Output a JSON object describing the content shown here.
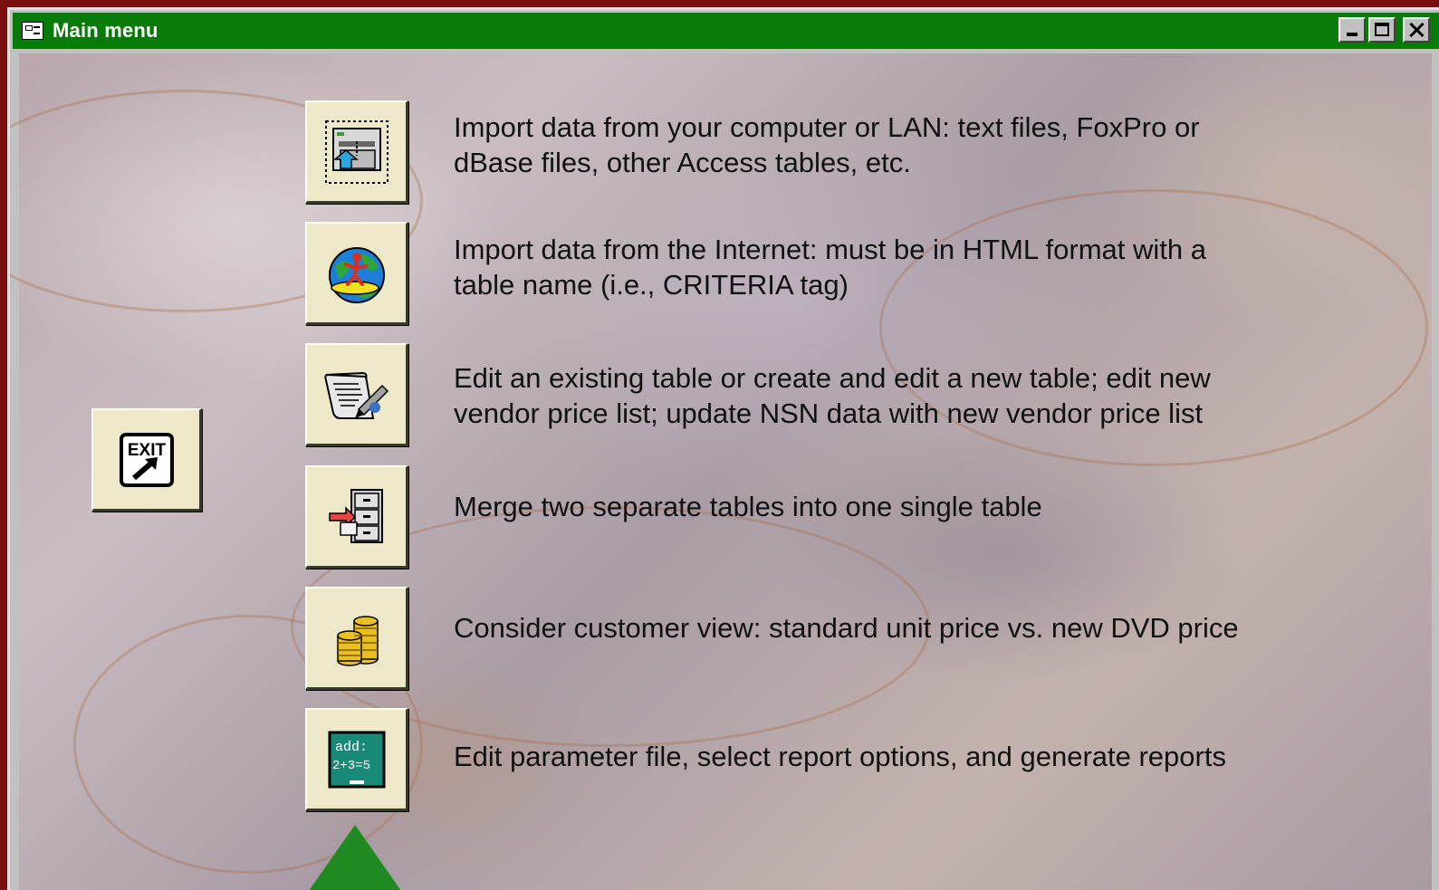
{
  "window": {
    "title": "Main menu"
  },
  "menu": [
    {
      "icon": "import-file-icon",
      "label_lines": [
        "Import data from your computer or LAN: text files, FoxPro or",
        "dBase files, other Access tables, etc."
      ]
    },
    {
      "icon": "internet-surfer-globe-icon",
      "label_lines": [
        "Import data from the Internet: must be in HTML format with a",
        "table name (i.e., CRITERIA tag)"
      ]
    },
    {
      "icon": "edit-table-scroll-icon",
      "label_lines": [
        "Edit an existing table or create and edit a new table; edit new",
        "vendor price list; update NSN data with new vendor price list"
      ]
    },
    {
      "icon": "merge-cabinet-icon",
      "label_lines": [
        "Merge two separate tables into one single table"
      ]
    },
    {
      "icon": "coin-stacks-icon",
      "label_lines": [
        "Consider customer view: standard unit price vs. new DVD price"
      ]
    },
    {
      "icon": "chalkboard-add-icon",
      "label_lines": [
        "Edit parameter file, select report options, and generate reports"
      ]
    }
  ],
  "exit": {
    "label": "EXIT"
  },
  "chalkboard": {
    "line1": "add:",
    "line2": "2+3=5"
  },
  "colors": {
    "titlebar": "#087a08",
    "button_face": "#ece8c8",
    "frame": "#7a0f10"
  }
}
